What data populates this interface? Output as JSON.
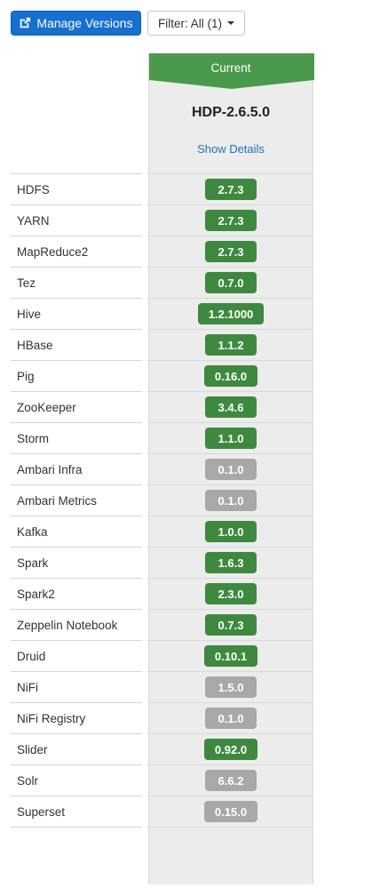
{
  "toolbar": {
    "manage_versions_label": "Manage Versions",
    "filter_label": "Filter: All (1)"
  },
  "version": {
    "header_label": "Current",
    "stack_name": "HDP-2.6.5.0",
    "show_details_label": "Show Details"
  },
  "colors": {
    "primary": "#1670d2",
    "current_header": "#4a9a4c",
    "badge_green": "#3d8a3f",
    "badge_grey": "#a8a8a8"
  },
  "services": [
    {
      "name": "HDFS",
      "version": "2.7.3",
      "status": "green"
    },
    {
      "name": "YARN",
      "version": "2.7.3",
      "status": "green"
    },
    {
      "name": "MapReduce2",
      "version": "2.7.3",
      "status": "green"
    },
    {
      "name": "Tez",
      "version": "0.7.0",
      "status": "green"
    },
    {
      "name": "Hive",
      "version": "1.2.1000",
      "status": "green"
    },
    {
      "name": "HBase",
      "version": "1.1.2",
      "status": "green"
    },
    {
      "name": "Pig",
      "version": "0.16.0",
      "status": "green"
    },
    {
      "name": "ZooKeeper",
      "version": "3.4.6",
      "status": "green"
    },
    {
      "name": "Storm",
      "version": "1.1.0",
      "status": "green"
    },
    {
      "name": "Ambari Infra",
      "version": "0.1.0",
      "status": "grey"
    },
    {
      "name": "Ambari Metrics",
      "version": "0.1.0",
      "status": "grey"
    },
    {
      "name": "Kafka",
      "version": "1.0.0",
      "status": "green"
    },
    {
      "name": "Spark",
      "version": "1.6.3",
      "status": "green"
    },
    {
      "name": "Spark2",
      "version": "2.3.0",
      "status": "green"
    },
    {
      "name": "Zeppelin Notebook",
      "version": "0.7.3",
      "status": "green"
    },
    {
      "name": "Druid",
      "version": "0.10.1",
      "status": "green"
    },
    {
      "name": "NiFi",
      "version": "1.5.0",
      "status": "grey"
    },
    {
      "name": "NiFi Registry",
      "version": "0.1.0",
      "status": "grey"
    },
    {
      "name": "Slider",
      "version": "0.92.0",
      "status": "green"
    },
    {
      "name": "Solr",
      "version": "6.6.2",
      "status": "grey"
    },
    {
      "name": "Superset",
      "version": "0.15.0",
      "status": "grey"
    }
  ]
}
